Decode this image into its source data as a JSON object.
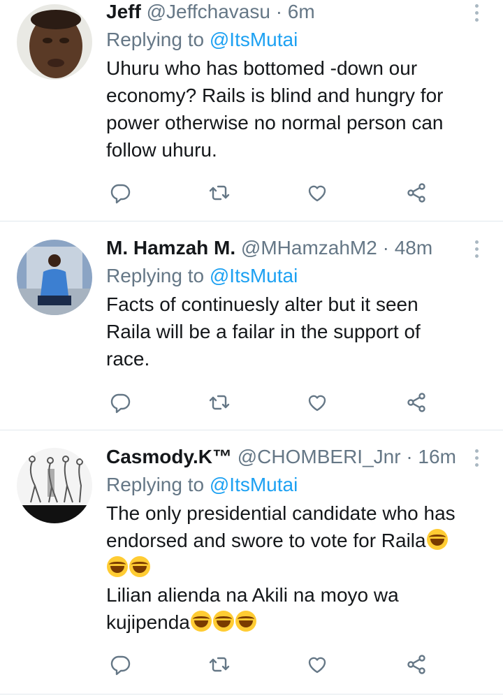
{
  "tweets": [
    {
      "name": "Jeff",
      "handle": "@Jeffchavasu",
      "time": "· 6m",
      "replying_prefix": "Replying to",
      "replying_to": "@ItsMutai",
      "lines": [
        "Uhuru who has bottomed -down our",
        "economy? Rails is blind and hungry for",
        "power otherwise no normal person can",
        "follow uhuru."
      ]
    },
    {
      "name": "M. Hamzah M.",
      "handle": "@MHamzahM2",
      "time": "· 48m",
      "replying_prefix": "Replying to",
      "replying_to": "@ItsMutai",
      "lines": [
        "Facts of continuesly alter but it seen",
        "Raila will be a failar in the support of",
        "race."
      ]
    },
    {
      "name": "Casmody.K™",
      "handle": "@CHOMBERI_Jnr",
      "time": "· 16m",
      "replying_prefix": "Replying to",
      "replying_to": "@ItsMutai",
      "lines": [
        "The only presidential candidate who has",
        "endorsed and swore to vote for Raila",
        "",
        "Lilian alienda na Akili na moyo wa",
        "kujipenda"
      ],
      "emoji": "face-with-tears-of-joy"
    }
  ],
  "icons": {
    "reply": "reply-icon",
    "retweet": "retweet-icon",
    "like": "like-icon",
    "share": "share-icon",
    "more": "more-options-icon"
  },
  "colors": {
    "name": "#14171a",
    "secondary": "#657786",
    "mention": "#1da1f2",
    "divider": "#e1e8ed"
  }
}
